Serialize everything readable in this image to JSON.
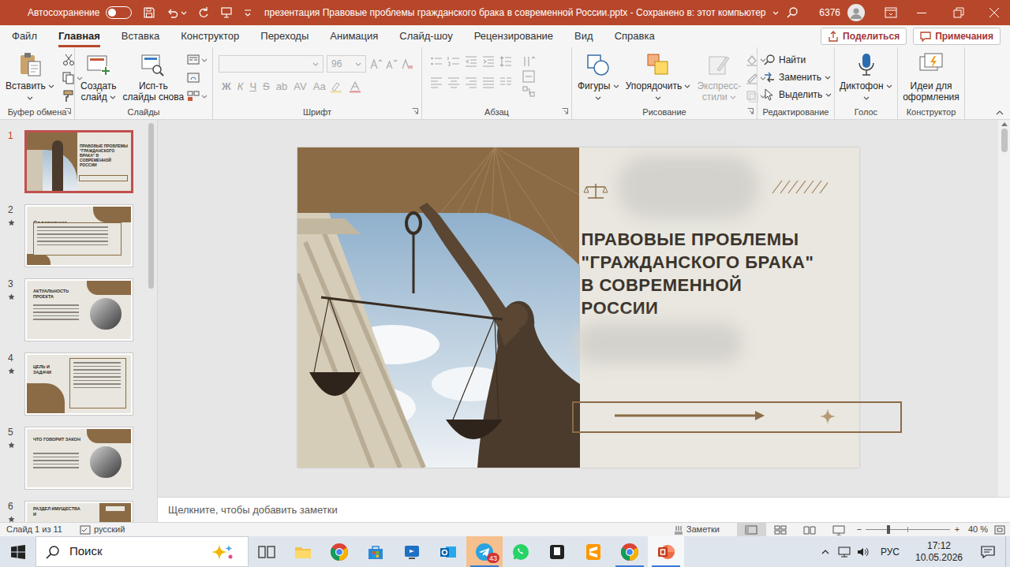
{
  "window": {
    "autosave_label": "Автосохранение",
    "autosave_on": false,
    "title": "презентация Правовые проблемы гражданского брака в современной России.pptx - Сохранено в: этот компьютер",
    "user": "6376"
  },
  "tabs": [
    {
      "label": "Файл",
      "selected": false
    },
    {
      "label": "Главная",
      "selected": true
    },
    {
      "label": "Вставка",
      "selected": false
    },
    {
      "label": "Конструктор",
      "selected": false
    },
    {
      "label": "Переходы",
      "selected": false
    },
    {
      "label": "Анимация",
      "selected": false
    },
    {
      "label": "Слайд-шоу",
      "selected": false
    },
    {
      "label": "Рецензирование",
      "selected": false
    },
    {
      "label": "Вид",
      "selected": false
    },
    {
      "label": "Справка",
      "selected": false
    }
  ],
  "share": {
    "label": "Поделиться"
  },
  "comments": {
    "label": "Примечания"
  },
  "ribbon": {
    "clipboard": {
      "label": "Буфер обмена",
      "paste": "Вставить"
    },
    "slides": {
      "label": "Слайды",
      "new_slide": [
        "Создать",
        "слайд"
      ],
      "reuse": [
        "Исп-ть",
        "слайды снова"
      ]
    },
    "font": {
      "label": "Шрифт",
      "size": "96",
      "disabled": true,
      "buttons": [
        "Ж",
        "К",
        "Ч",
        "S",
        "ab",
        "AV",
        "Аа"
      ]
    },
    "paragraph": {
      "label": "Абзац",
      "disabled": true
    },
    "drawing": {
      "label": "Рисование",
      "shapes": "Фигуры",
      "arrange": "Упорядочить",
      "quick_styles": [
        "Экспресс-",
        "стили"
      ],
      "quick_styles_disabled": true
    },
    "editing": {
      "label": "Редактирование",
      "find": "Найти",
      "replace": "Заменить",
      "select": "Выделить"
    },
    "voice": {
      "label": "Голос",
      "dictate": "Диктофон"
    },
    "designer": {
      "label": "Конструктор",
      "ideas": [
        "Идеи для",
        "оформления"
      ]
    }
  },
  "slides_panel": [
    {
      "number": "1",
      "title": "ПРАВОВЫЕ ПРОБЛЕМЫ \"ГРАЖДАНСКОГО БРАКА\" В СОВРЕМЕННОЙ РОССИИ",
      "selected": true,
      "transition": false,
      "kind": "title"
    },
    {
      "number": "2",
      "title": "Содержание",
      "selected": false,
      "transition": true,
      "kind": "contents"
    },
    {
      "number": "3",
      "title": "АКТУАЛЬНОСТЬ ПРОЕКТА",
      "selected": false,
      "transition": true,
      "kind": "circle"
    },
    {
      "number": "4",
      "title": "ЦЕЛЬ И ЗАДАЧИ",
      "selected": false,
      "transition": true,
      "kind": "split"
    },
    {
      "number": "5",
      "title": "ЧТО ГОВОРИТ ЗАКОН",
      "selected": false,
      "transition": true,
      "kind": "circle"
    },
    {
      "number": "6",
      "title": "РАЗДЕЛ ИМУЩЕСТВА И",
      "selected": false,
      "transition": true,
      "kind": "box"
    }
  ],
  "slide": {
    "title": [
      "ПРАВОВЫЕ ПРОБЛЕМЫ",
      "\"ГРАЖДАНСКОГО БРАКА\"",
      "В СОВРЕМЕННОЙ",
      "РОССИИ"
    ]
  },
  "notes": {
    "placeholder": "Щелкните, чтобы добавить заметки"
  },
  "status_bar": {
    "slide": "Слайд 1 из 11",
    "language": "русский",
    "notes": "Заметки",
    "views": [
      {
        "selected": true
      },
      {
        "selected": false
      },
      {
        "selected": false
      },
      {
        "selected": false
      }
    ],
    "zoom_out": "−",
    "zoom_in": "+",
    "zoom_level": 0.27,
    "zoom": "40 %"
  },
  "taskbar": {
    "search": "Поиск",
    "apps": [
      {
        "running": false,
        "selected": false,
        "flashing": false
      },
      {
        "running": false,
        "selected": false,
        "flashing": false
      },
      {
        "running": false,
        "selected": false,
        "flashing": false
      },
      {
        "running": false,
        "selected": false,
        "flashing": false
      },
      {
        "running": false,
        "selected": false,
        "flashing": false
      },
      {
        "running": false,
        "selected": false,
        "flashing": false
      },
      {
        "running": true,
        "selected": false,
        "flashing": true,
        "badge": "43"
      },
      {
        "running": false,
        "selected": false,
        "flashing": false
      },
      {
        "running": false,
        "selected": false,
        "flashing": false
      },
      {
        "running": false,
        "selected": false,
        "flashing": false
      },
      {
        "running": true,
        "selected": false,
        "flashing": false
      },
      {
        "running": true,
        "selected": true,
        "flashing": false
      }
    ],
    "language": "РУС",
    "time": "17:12",
    "date": "10.05.2026"
  }
}
